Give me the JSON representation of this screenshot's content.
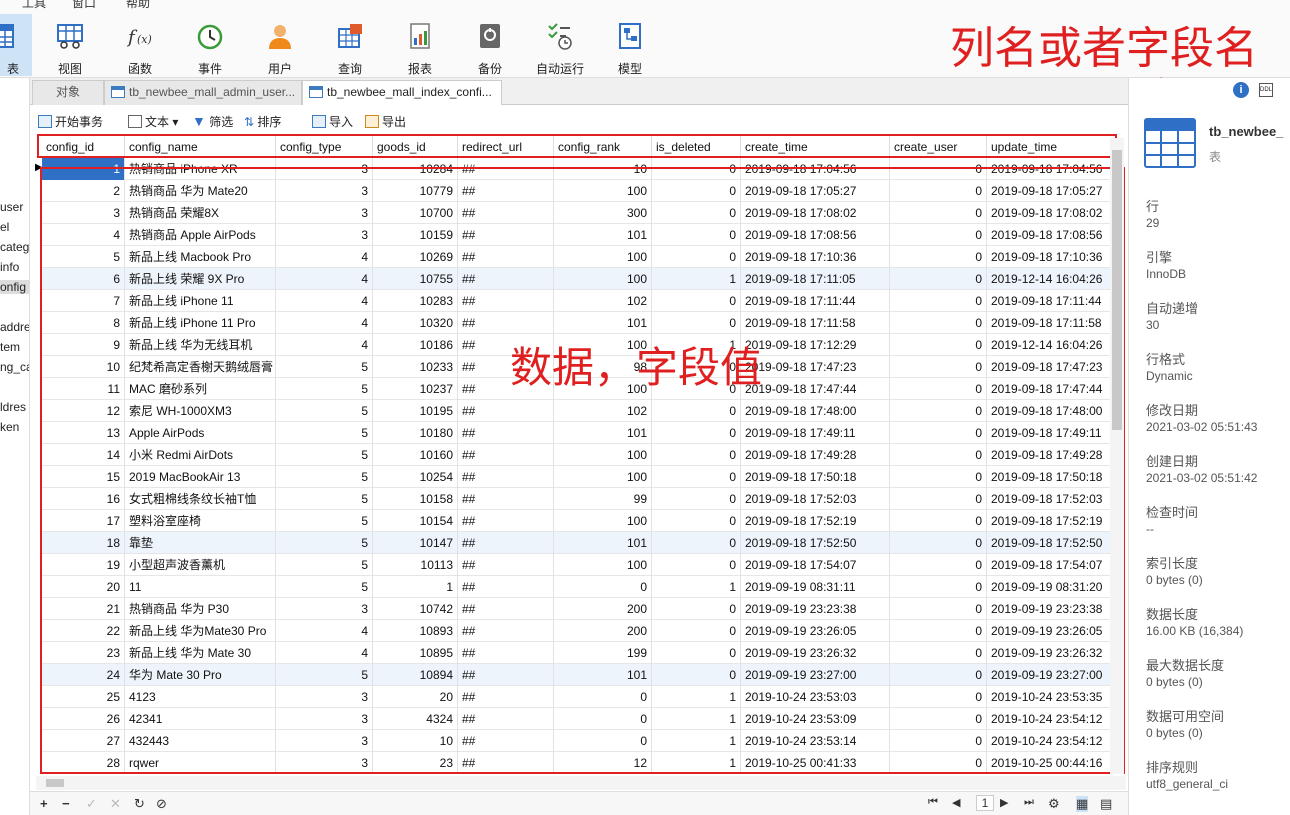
{
  "menu": {
    "items": [
      "工具",
      "窗口",
      "帮助"
    ]
  },
  "ribbon": {
    "buttons": [
      {
        "label": "表",
        "icon": "table-icon"
      },
      {
        "label": "视图",
        "icon": "view-icon"
      },
      {
        "label": "函数",
        "icon": "function-icon"
      },
      {
        "label": "事件",
        "icon": "clock-icon"
      },
      {
        "label": "用户",
        "icon": "user-icon"
      },
      {
        "label": "查询",
        "icon": "query-icon"
      },
      {
        "label": "报表",
        "icon": "report-icon"
      },
      {
        "label": "备份",
        "icon": "backup-icon"
      },
      {
        "label": "自动运行",
        "icon": "schedule-icon"
      },
      {
        "label": "模型",
        "icon": "model-icon"
      }
    ]
  },
  "sidebar": {
    "items": [
      "user",
      "el",
      "categ",
      "info",
      "onfig",
      "addre",
      "tem",
      "ng_ca",
      "ldres",
      "ken"
    ]
  },
  "tabs": [
    "对象",
    "tb_newbee_mall_admin_user...",
    "tb_newbee_mall_index_confi..."
  ],
  "toolbar": {
    "begin_tx": "开始事务",
    "text": "文本",
    "filter": "筛选",
    "sort": "排序",
    "import": "导入",
    "export": "导出"
  },
  "table": {
    "columns": [
      "config_id",
      "config_name",
      "config_type",
      "goods_id",
      "redirect_url",
      "config_rank",
      "is_deleted",
      "create_time",
      "create_user",
      "update_time"
    ],
    "rows": [
      [
        "1",
        "热销商品 iPhone XR",
        "3",
        "10284",
        "##",
        "10",
        "0",
        "2019-09-18 17:04:56",
        "0",
        "2019-09-18 17:04:56"
      ],
      [
        "2",
        "热销商品 华为 Mate20",
        "3",
        "10779",
        "##",
        "100",
        "0",
        "2019-09-18 17:05:27",
        "0",
        "2019-09-18 17:05:27"
      ],
      [
        "3",
        "热销商品 荣耀8X",
        "3",
        "10700",
        "##",
        "300",
        "0",
        "2019-09-18 17:08:02",
        "0",
        "2019-09-18 17:08:02"
      ],
      [
        "4",
        "热销商品 Apple AirPods",
        "3",
        "10159",
        "##",
        "101",
        "0",
        "2019-09-18 17:08:56",
        "0",
        "2019-09-18 17:08:56"
      ],
      [
        "5",
        "新品上线 Macbook Pro",
        "4",
        "10269",
        "##",
        "100",
        "0",
        "2019-09-18 17:10:36",
        "0",
        "2019-09-18 17:10:36"
      ],
      [
        "6",
        "新品上线 荣耀 9X Pro",
        "4",
        "10755",
        "##",
        "100",
        "1",
        "2019-09-18 17:11:05",
        "0",
        "2019-12-14 16:04:26"
      ],
      [
        "7",
        "新品上线 iPhone 11",
        "4",
        "10283",
        "##",
        "102",
        "0",
        "2019-09-18 17:11:44",
        "0",
        "2019-09-18 17:11:44"
      ],
      [
        "8",
        "新品上线 iPhone 11 Pro",
        "4",
        "10320",
        "##",
        "101",
        "0",
        "2019-09-18 17:11:58",
        "0",
        "2019-09-18 17:11:58"
      ],
      [
        "9",
        "新品上线 华为无线耳机",
        "4",
        "10186",
        "##",
        "100",
        "1",
        "2019-09-18 17:12:29",
        "0",
        "2019-12-14 16:04:26"
      ],
      [
        "10",
        "纪梵希高定香榭天鹅绒唇膏",
        "5",
        "10233",
        "##",
        "98",
        "0",
        "2019-09-18 17:47:23",
        "0",
        "2019-09-18 17:47:23"
      ],
      [
        "11",
        "MAC 磨砂系列",
        "5",
        "10237",
        "##",
        "100",
        "0",
        "2019-09-18 17:47:44",
        "0",
        "2019-09-18 17:47:44"
      ],
      [
        "12",
        "索尼 WH-1000XM3",
        "5",
        "10195",
        "##",
        "102",
        "0",
        "2019-09-18 17:48:00",
        "0",
        "2019-09-18 17:48:00"
      ],
      [
        "13",
        "Apple AirPods",
        "5",
        "10180",
        "##",
        "101",
        "0",
        "2019-09-18 17:49:11",
        "0",
        "2019-09-18 17:49:11"
      ],
      [
        "14",
        "小米 Redmi AirDots",
        "5",
        "10160",
        "##",
        "100",
        "0",
        "2019-09-18 17:49:28",
        "0",
        "2019-09-18 17:49:28"
      ],
      [
        "15",
        "2019 MacBookAir 13",
        "5",
        "10254",
        "##",
        "100",
        "0",
        "2019-09-18 17:50:18",
        "0",
        "2019-09-18 17:50:18"
      ],
      [
        "16",
        "女式粗棉线条纹长袖T恤",
        "5",
        "10158",
        "##",
        "99",
        "0",
        "2019-09-18 17:52:03",
        "0",
        "2019-09-18 17:52:03"
      ],
      [
        "17",
        "塑料浴室座椅",
        "5",
        "10154",
        "##",
        "100",
        "0",
        "2019-09-18 17:52:19",
        "0",
        "2019-09-18 17:52:19"
      ],
      [
        "18",
        "靠垫",
        "5",
        "10147",
        "##",
        "101",
        "0",
        "2019-09-18 17:52:50",
        "0",
        "2019-09-18 17:52:50"
      ],
      [
        "19",
        "小型超声波香薰机",
        "5",
        "10113",
        "##",
        "100",
        "0",
        "2019-09-18 17:54:07",
        "0",
        "2019-09-18 17:54:07"
      ],
      [
        "20",
        "11",
        "5",
        "1",
        "##",
        "0",
        "1",
        "2019-09-19 08:31:11",
        "0",
        "2019-09-19 08:31:20"
      ],
      [
        "21",
        "热销商品 华为 P30",
        "3",
        "10742",
        "##",
        "200",
        "0",
        "2019-09-19 23:23:38",
        "0",
        "2019-09-19 23:23:38"
      ],
      [
        "22",
        "新品上线 华为Mate30 Pro",
        "4",
        "10893",
        "##",
        "200",
        "0",
        "2019-09-19 23:26:05",
        "0",
        "2019-09-19 23:26:05"
      ],
      [
        "23",
        "新品上线 华为 Mate 30",
        "4",
        "10895",
        "##",
        "199",
        "0",
        "2019-09-19 23:26:32",
        "0",
        "2019-09-19 23:26:32"
      ],
      [
        "24",
        "华为 Mate 30 Pro",
        "5",
        "10894",
        "##",
        "101",
        "0",
        "2019-09-19 23:27:00",
        "0",
        "2019-09-19 23:27:00"
      ],
      [
        "25",
        "4123",
        "3",
        "20",
        "##",
        "0",
        "1",
        "2019-10-24 23:53:03",
        "0",
        "2019-10-24 23:53:35"
      ],
      [
        "26",
        "42341",
        "3",
        "4324",
        "##",
        "0",
        "1",
        "2019-10-24 23:53:09",
        "0",
        "2019-10-24 23:54:12"
      ],
      [
        "27",
        "432443",
        "3",
        "10",
        "##",
        "0",
        "1",
        "2019-10-24 23:53:14",
        "0",
        "2019-10-24 23:54:12"
      ],
      [
        "28",
        "rqwer",
        "3",
        "23",
        "##",
        "12",
        "1",
        "2019-10-25 00:41:33",
        "0",
        "2019-10-25 00:44:16"
      ]
    ]
  },
  "annotations": {
    "column_names": "列名或者字段名",
    "data_values": "数据，字段值"
  },
  "pagination": {
    "page": "1"
  },
  "info": {
    "table_name": "tb_newbee_",
    "table_type": "表",
    "fields": [
      {
        "label": "行",
        "value": "29"
      },
      {
        "label": "引擎",
        "value": "InnoDB"
      },
      {
        "label": "自动递增",
        "value": "30"
      },
      {
        "label": "行格式",
        "value": "Dynamic"
      },
      {
        "label": "修改日期",
        "value": "2021-03-02 05:51:43"
      },
      {
        "label": "创建日期",
        "value": "2021-03-02 05:51:42"
      },
      {
        "label": "检查时间",
        "value": "--"
      },
      {
        "label": "索引长度",
        "value": "0 bytes (0)"
      },
      {
        "label": "数据长度",
        "value": "16.00 KB (16,384)"
      },
      {
        "label": "最大数据长度",
        "value": "0 bytes (0)"
      },
      {
        "label": "数据可用空间",
        "value": "0 bytes (0)"
      },
      {
        "label": "排序规则",
        "value": "utf8_general_ci"
      }
    ]
  },
  "colors": {
    "accent": "#2f6fc5",
    "annotation": "#e02020",
    "alt_row": "#eef4fb"
  }
}
